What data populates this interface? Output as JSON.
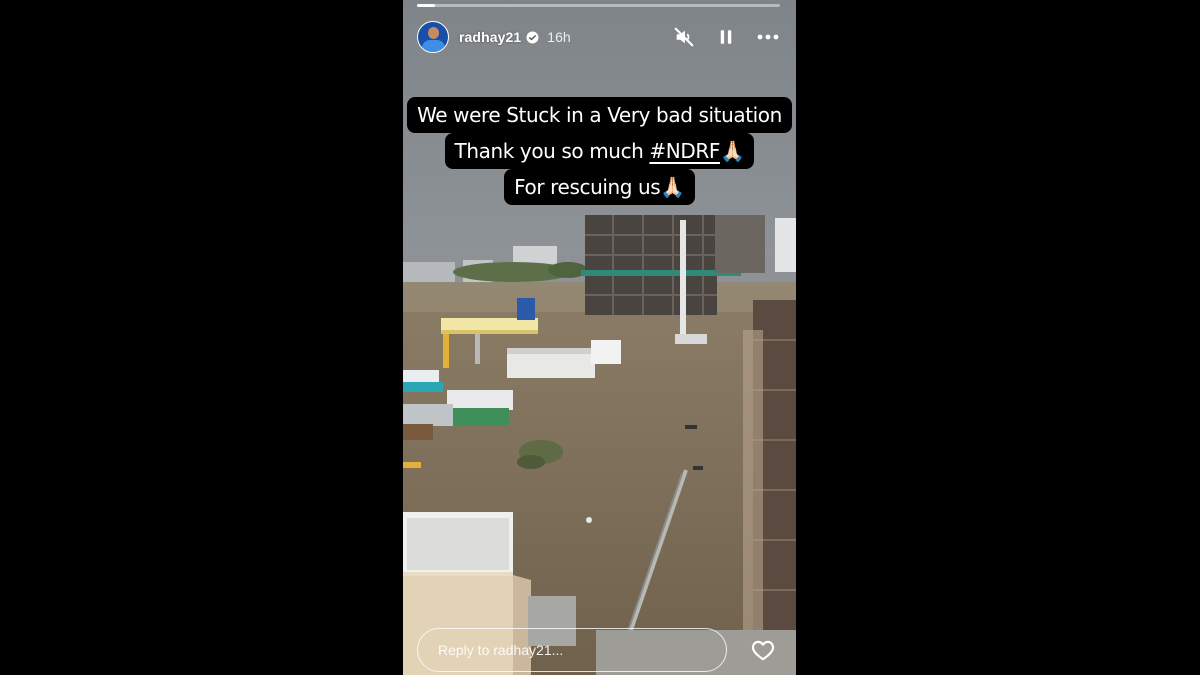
{
  "story": {
    "progress": 0.05,
    "header": {
      "username": "radhay21",
      "time": "16h"
    },
    "caption": {
      "line1": "We were Stuck in a Very bad situation",
      "line2_prefix": "Thank you so much ",
      "line2_tag": "#NDRF",
      "line2_emoji": "🙏🏻",
      "line3": "For rescuing us",
      "line3_emoji": "🙏🏻"
    },
    "footer": {
      "reply_placeholder": "Reply to radhay21..."
    }
  },
  "icons": {
    "mute": "muted-speaker-icon",
    "pause": "pause-icon",
    "more": "more-horizontal-icon",
    "verified": "verified-badge-icon",
    "like": "heart-outline-icon"
  },
  "colors": {
    "background": "#000000",
    "caption_bg": "#000000",
    "verified": "#3897f0"
  }
}
